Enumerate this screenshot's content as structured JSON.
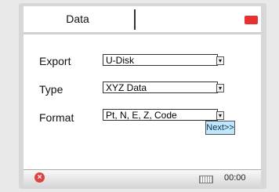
{
  "tabs": {
    "data_label": "Data"
  },
  "form": {
    "export_label": "Export",
    "export_value": "U-Disk",
    "type_label": "Type",
    "type_value": "XYZ Data",
    "format_label": "Format",
    "format_value": "Pt, N, E, Z, Code"
  },
  "actions": {
    "next_label": "Next>>"
  },
  "status": {
    "time": "00:00"
  },
  "colors": {
    "battery": "#e53131",
    "next_bg": "#bfe6ff",
    "close_icon": "#d44444"
  },
  "icons": {
    "battery": "battery-icon",
    "close": "close-icon",
    "keyboard": "keyboard-icon",
    "dropdown": "chevron-down-icon"
  }
}
